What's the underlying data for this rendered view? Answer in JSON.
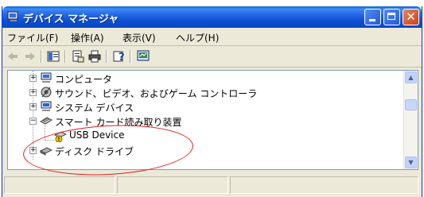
{
  "window": {
    "title": "デバイス マネージャ"
  },
  "menu": [
    {
      "label": "ファイル(F)"
    },
    {
      "label": "操作(A)"
    },
    {
      "label": "表示(V)"
    },
    {
      "label": "ヘルプ(H)"
    }
  ],
  "tree": {
    "items": [
      {
        "label": "コンピュータ",
        "icon": "computer-icon",
        "expander": "+"
      },
      {
        "label": "サウンド、ビデオ、およびゲーム コントローラ",
        "icon": "sound-icon",
        "expander": "+"
      },
      {
        "label": "システム デバイス",
        "icon": "system-device-icon",
        "expander": "+"
      },
      {
        "label": "スマート カード読み取り装置",
        "icon": "smart-card-reader-icon",
        "expander": "−"
      },
      {
        "label": "USB Device",
        "icon": "usb-device-warning-icon",
        "expander": ""
      },
      {
        "label": "ディスク ドライブ",
        "icon": "disk-drive-icon",
        "expander": "+"
      }
    ]
  },
  "colors": {
    "titlebar": "#0a4ed0",
    "highlight_ellipse": "#e11d1d"
  }
}
